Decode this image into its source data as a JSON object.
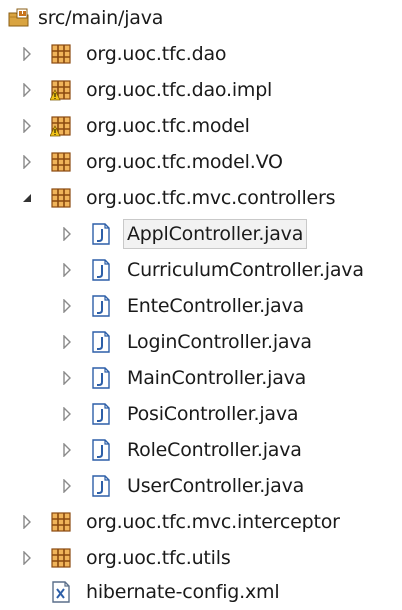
{
  "tree": {
    "root": {
      "label": "src/main/java",
      "icon": "source-folder-icon"
    },
    "packages_top": [
      {
        "label": "org.uoc.tfc.dao",
        "icon": "package-icon",
        "warning": false,
        "expanded": false
      },
      {
        "label": "org.uoc.tfc.dao.impl",
        "icon": "package-warning-icon",
        "warning": true,
        "expanded": false
      },
      {
        "label": "org.uoc.tfc.model",
        "icon": "package-warning-icon",
        "warning": true,
        "expanded": false
      },
      {
        "label": "org.uoc.tfc.model.VO",
        "icon": "package-icon",
        "warning": false,
        "expanded": false
      },
      {
        "label": "org.uoc.tfc.mvc.controllers",
        "icon": "package-icon",
        "warning": false,
        "expanded": true
      }
    ],
    "controllers": [
      {
        "label": "ApplController.java",
        "icon": "java-file-icon",
        "selected": true
      },
      {
        "label": "CurriculumController.java",
        "icon": "java-file-icon",
        "selected": false
      },
      {
        "label": "EnteController.java",
        "icon": "java-file-icon",
        "selected": false
      },
      {
        "label": "LoginController.java",
        "icon": "java-file-icon",
        "selected": false
      },
      {
        "label": "MainController.java",
        "icon": "java-file-icon",
        "selected": false
      },
      {
        "label": "PosiController.java",
        "icon": "java-file-icon",
        "selected": false
      },
      {
        "label": "RoleController.java",
        "icon": "java-file-icon",
        "selected": false
      },
      {
        "label": "UserController.java",
        "icon": "java-file-icon",
        "selected": false
      }
    ],
    "packages_bottom": [
      {
        "label": "org.uoc.tfc.mvc.interceptor",
        "icon": "package-icon",
        "expanded": false
      },
      {
        "label": "org.uoc.tfc.utils",
        "icon": "package-icon",
        "expanded": false
      }
    ],
    "xml_file": {
      "label": "hibernate-config.xml",
      "icon": "xml-file-icon"
    }
  },
  "colors": {
    "package_orange": "#c8741c",
    "package_dark": "#8a4a10",
    "java_blue": "#2d5fa8",
    "warning_yellow": "#f3c518",
    "arrow_gray": "#8a8a8a",
    "selection_bg": "#f2f2f2",
    "selection_border": "#c9c9c9"
  }
}
